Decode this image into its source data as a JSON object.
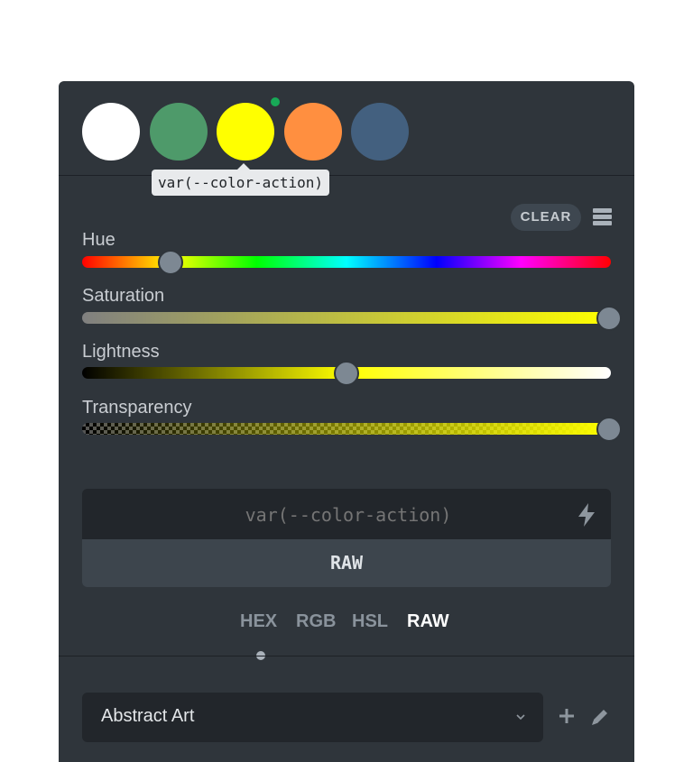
{
  "swatches": [
    {
      "name": "white",
      "color": "#ffffff"
    },
    {
      "name": "green",
      "color": "#4e9a6a"
    },
    {
      "name": "yellow",
      "color": "#ffff00"
    },
    {
      "name": "orange",
      "color": "#ff8f40"
    },
    {
      "name": "blue",
      "color": "#43607f"
    }
  ],
  "tooltip": "var(--color-action)",
  "clear_label": "CLEAR",
  "sliders": {
    "hue": {
      "label": "Hue",
      "value": 60,
      "max": 360
    },
    "saturation": {
      "label": "Saturation",
      "value": 100,
      "max": 100
    },
    "lightness": {
      "label": "Lightness",
      "value": 50,
      "max": 100
    },
    "transparency": {
      "label": "Transparency",
      "value": 100,
      "max": 100
    }
  },
  "value_input": {
    "placeholder": "var(--color-action)"
  },
  "format_label": "RAW",
  "tabs": [
    {
      "label": "HEX",
      "active": false
    },
    {
      "label": "RGB",
      "active": false
    },
    {
      "label": "HSL",
      "active": false
    },
    {
      "label": "RAW",
      "active": true
    }
  ],
  "palette": {
    "label": "Abstract Art"
  },
  "icons": {
    "menu": "menu-icon",
    "bolt": "bolt-icon",
    "chevron": "chevron-down-icon",
    "plus": "plus-icon",
    "pencil": "pencil-icon"
  },
  "colors": {
    "panel": "#2f353b",
    "active_indicator": "#18a957"
  }
}
